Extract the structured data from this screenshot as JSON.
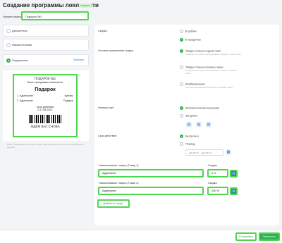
{
  "header": {
    "title": "Создание программы лояльности",
    "badge": "Новинка"
  },
  "name_field": {
    "label": "Наименование",
    "value": "Подарок №1"
  },
  "program_types": [
    {
      "label": "Дисконтная",
      "selected": false
    },
    {
      "label": "Накопительная",
      "selected": false
    },
    {
      "label": "Подарочная",
      "selected": true,
      "link": "Выбрана"
    }
  ],
  "ticket": {
    "line1": "ПОДАРОК №1",
    "line2": "Билет программы лояльности",
    "title": "Подарок",
    "items": [
      {
        "left": "1. Адреналин",
        "right": "Купоны"
      },
      {
        "left": "2. Адреналин",
        "right": "Подарок"
      }
    ],
    "valid_label": "Срок действия",
    "valid_date": "с 17.08.2022",
    "bye": "ЖДЕМ ВАС СНОВА"
  },
  "left_hint": "Билет программы лояльности будет распечатан на чеке после информации о покупке",
  "settings": {
    "discount": {
      "label": "Скидка",
      "options": [
        "В рублях",
        "В процентах"
      ],
      "selected": 1
    },
    "condition": {
      "label": "Условие применения скидки",
      "options": [
        {
          "title": "Товары только в одном чеке",
          "desc": "Подарок или скидка на выбранные товары в одном чеке"
        },
        {
          "title": "Товары только в разных чеках",
          "desc": "Подарок или скидка на выбранные товары в разных чеках"
        },
        {
          "title": "Комбинировано",
          "desc": "При использовании в одном или в разных чеках"
        }
      ],
      "selected": 0
    },
    "cards": {
      "label": "Номера карт",
      "options": [
        "Автоматическая генерация",
        "Загрузить"
      ],
      "selected": 0
    },
    "period": {
      "label": "Срок действия",
      "options": [
        "Бессрочно",
        "Период"
      ],
      "selected": 0,
      "range_placeholder": "дд.мм.гг - дд.мм.гг"
    }
  },
  "products": [
    {
      "name_label": "Наименование товара (Товар 1)",
      "name_value": "Адреналин",
      "discount_label": "Скидка",
      "discount_value": "0 %"
    },
    {
      "name_label": "Наименование товара (Товар 2)",
      "name_value": "Адреналин",
      "discount_label": "Скидка",
      "discount_value": "100 %"
    }
  ],
  "add_product": "+ Добавить товар",
  "footer": {
    "save": "Сохранить",
    "run": "Запустить"
  },
  "colors": {
    "accent": "#2fb14f",
    "highlight": "#4fd64f",
    "link": "#3b82c4"
  }
}
